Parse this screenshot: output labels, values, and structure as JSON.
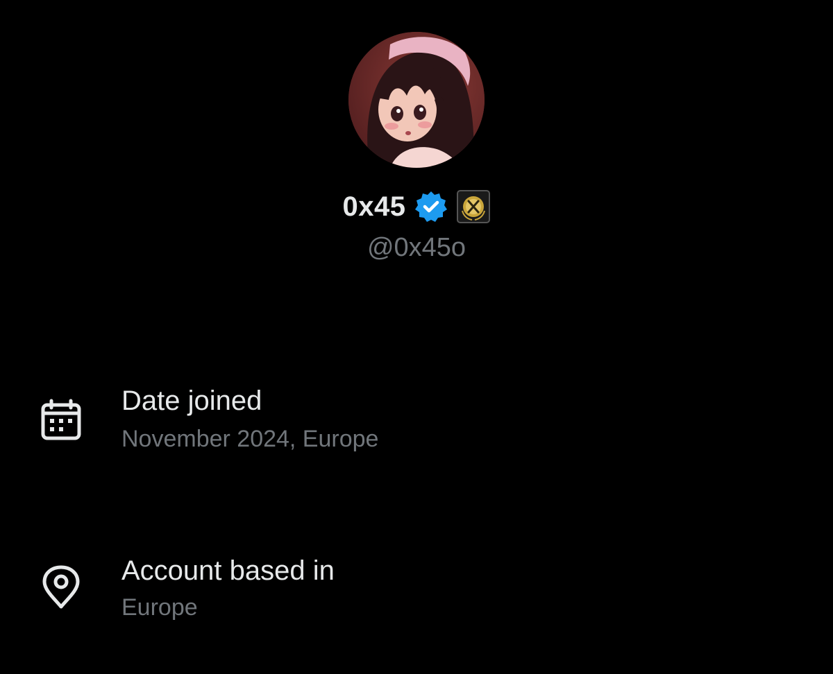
{
  "profile": {
    "display_name": "0x45",
    "handle": "@0x45o",
    "badges": [
      "verified-badge-icon",
      "affiliate-badge-icon"
    ]
  },
  "about": {
    "date_joined": {
      "label": "Date joined",
      "value": "November 2024, Europe",
      "icon": "calendar-icon"
    },
    "account_based_in": {
      "label": "Account based in",
      "value": "Europe",
      "icon": "location-pin-icon"
    }
  },
  "colors": {
    "background": "#000000",
    "primary_text": "#e7e9ea",
    "secondary_text": "#71767b",
    "verified_blue": "#1d9bf0",
    "affiliate_gold": "#c9a53a"
  }
}
